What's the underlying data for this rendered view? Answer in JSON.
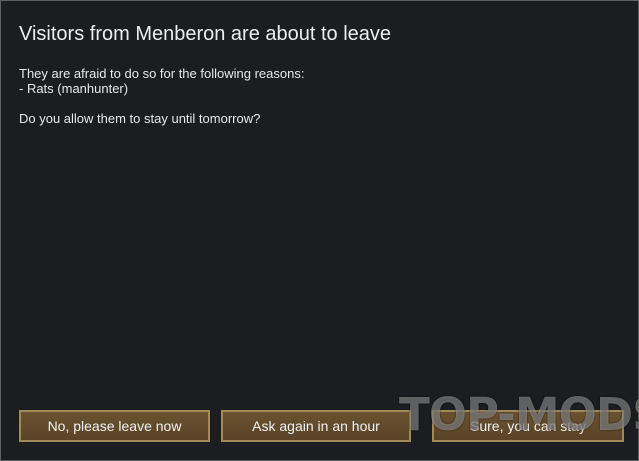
{
  "dialog": {
    "title": "Visitors from Menberon are about to leave",
    "body": {
      "intro": "They are afraid to do so for the following reasons:",
      "reasons": [
        "- Rats (manhunter)"
      ],
      "question": "Do you allow them to stay until tomorrow?"
    },
    "buttons": {
      "no": "No, please leave now",
      "ask": "Ask again in an hour",
      "sure": "Sure, you can stay"
    }
  },
  "watermark": "TOP-MODS.RU",
  "colors": {
    "background": "#1b1d21",
    "button_fill": "#5f4a2c",
    "button_border": "#a18c58",
    "text": "#e8e8e8"
  }
}
